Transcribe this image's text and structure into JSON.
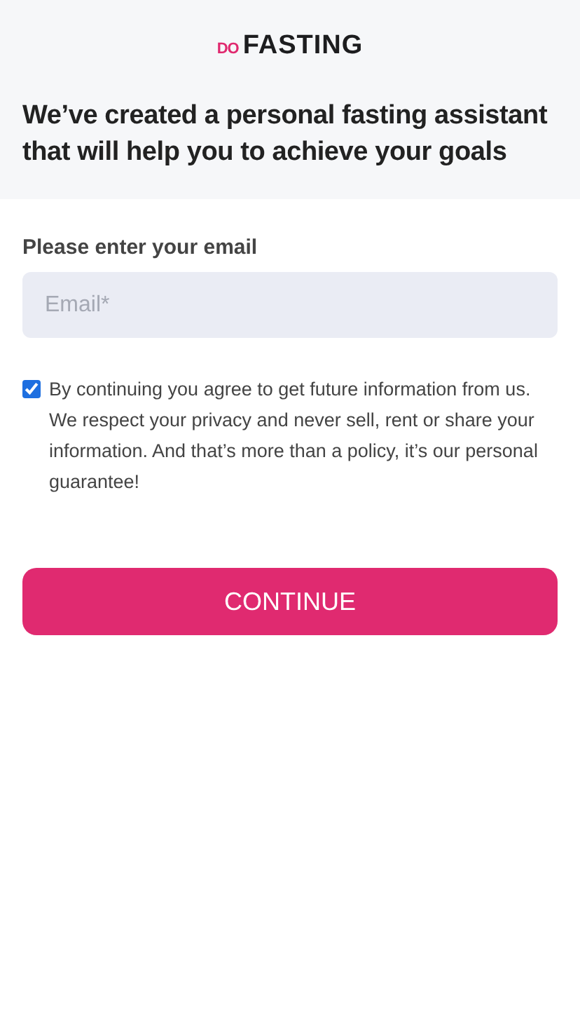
{
  "logo": {
    "prefix": "DO",
    "name": "FASTING"
  },
  "headline": "We’ve created a personal fasting assistant that will help you to achieve your goals",
  "email": {
    "label": "Please enter your email",
    "placeholder": "Email*"
  },
  "consent": {
    "checked": true,
    "text": "By continuing you agree to get future information from us. We respect your privacy and never sell, rent or share your information. And that’s more than a policy, it’s our personal guarantee!"
  },
  "button": "CONTINUE"
}
